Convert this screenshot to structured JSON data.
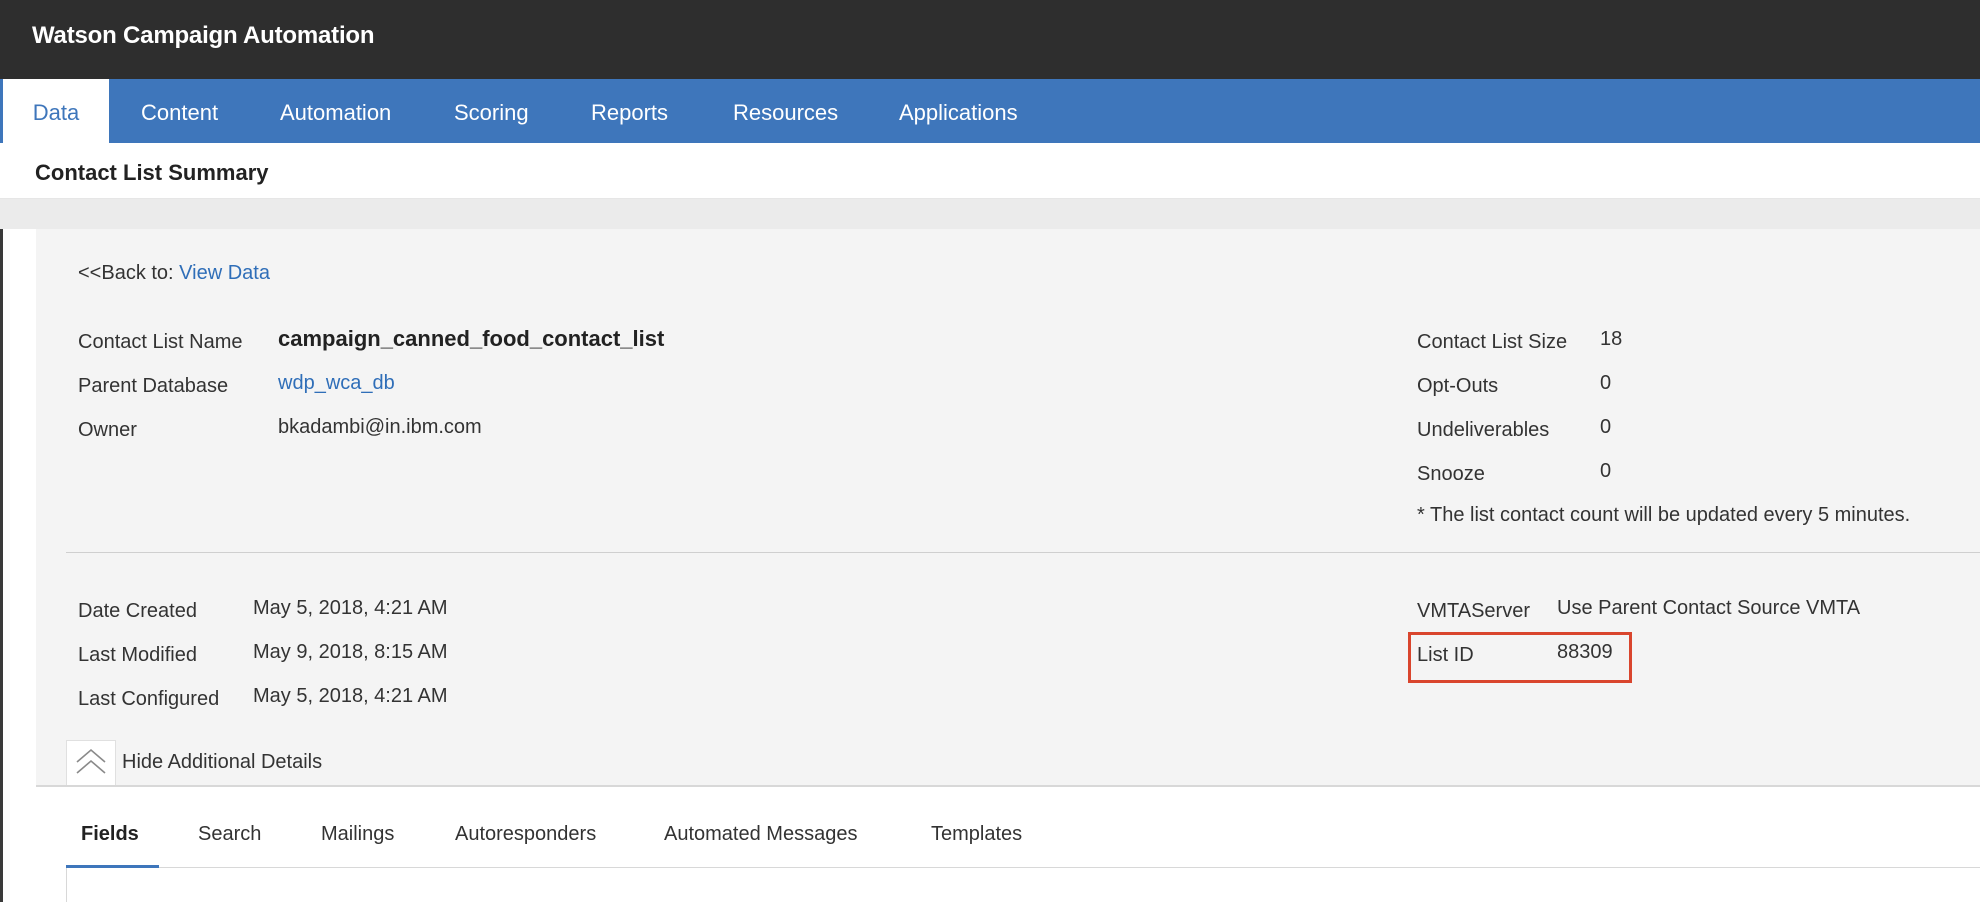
{
  "app": {
    "title": "Watson Campaign Automation"
  },
  "nav": {
    "tabs": [
      {
        "label": "Data",
        "active": true
      },
      {
        "label": "Content"
      },
      {
        "label": "Automation"
      },
      {
        "label": "Scoring"
      },
      {
        "label": "Reports"
      },
      {
        "label": "Resources"
      },
      {
        "label": "Applications"
      }
    ]
  },
  "page": {
    "title": "Contact List Summary"
  },
  "back": {
    "prefix": "<<Back to: ",
    "link": "View Data"
  },
  "summary": {
    "list_name_label": "Contact List Name",
    "list_name": "campaign_canned_food_contact_list",
    "parent_db_label": "Parent Database",
    "parent_db": "wdp_wca_db",
    "owner_label": "Owner",
    "owner": "bkadambi@in.ibm.com",
    "size_label": "Contact List Size",
    "size": "18",
    "optouts_label": "Opt-Outs",
    "optouts": "0",
    "undeliverables_label": "Undeliverables",
    "undeliverables": "0",
    "snooze_label": "Snooze",
    "snooze": "0",
    "count_note": "* The list contact count will be updated every 5 minutes."
  },
  "details": {
    "created_label": "Date Created",
    "created": "May 5, 2018, 4:21 AM",
    "modified_label": "Last Modified",
    "modified": "May 9, 2018, 8:15 AM",
    "configured_label": "Last Configured",
    "configured": "May 5, 2018, 4:21 AM",
    "vmta_label": "VMTAServer",
    "vmta": "Use Parent Contact Source VMTA",
    "list_id_label": "List ID",
    "list_id": "88309",
    "toggle_label": "Hide Additional Details"
  },
  "subtabs": [
    {
      "label": "Fields",
      "active": true
    },
    {
      "label": "Search"
    },
    {
      "label": "Mailings"
    },
    {
      "label": "Autoresponders"
    },
    {
      "label": "Automated Messages"
    },
    {
      "label": "Templates"
    }
  ],
  "colors": {
    "nav": "#3e76bb",
    "topbar": "#2e2e2e",
    "link": "#2f6eb8",
    "highlight": "#d9452d"
  }
}
